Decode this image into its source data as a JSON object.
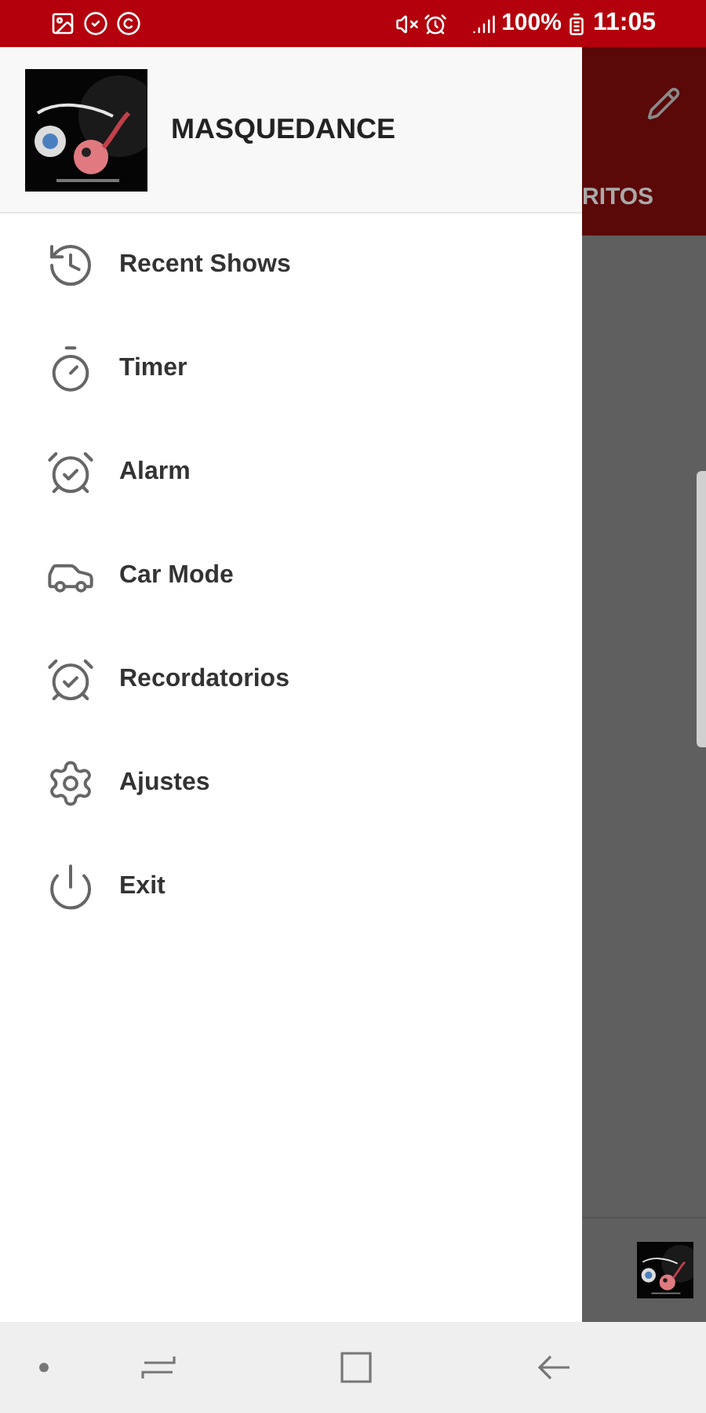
{
  "status_bar": {
    "battery": "100%",
    "time": "11:05"
  },
  "drawer": {
    "title": "MASQUEDANCE",
    "items": [
      {
        "kind": "history",
        "label": "Recent Shows"
      },
      {
        "kind": "timer",
        "label": "Timer"
      },
      {
        "kind": "alarm",
        "label": "Alarm"
      },
      {
        "kind": "car",
        "label": "Car Mode"
      },
      {
        "kind": "alarm",
        "label": "Recordatorios"
      },
      {
        "kind": "settings",
        "label": "Ajustes"
      },
      {
        "kind": "power",
        "label": "Exit"
      }
    ]
  },
  "background_app": {
    "tab": "RITOS"
  }
}
